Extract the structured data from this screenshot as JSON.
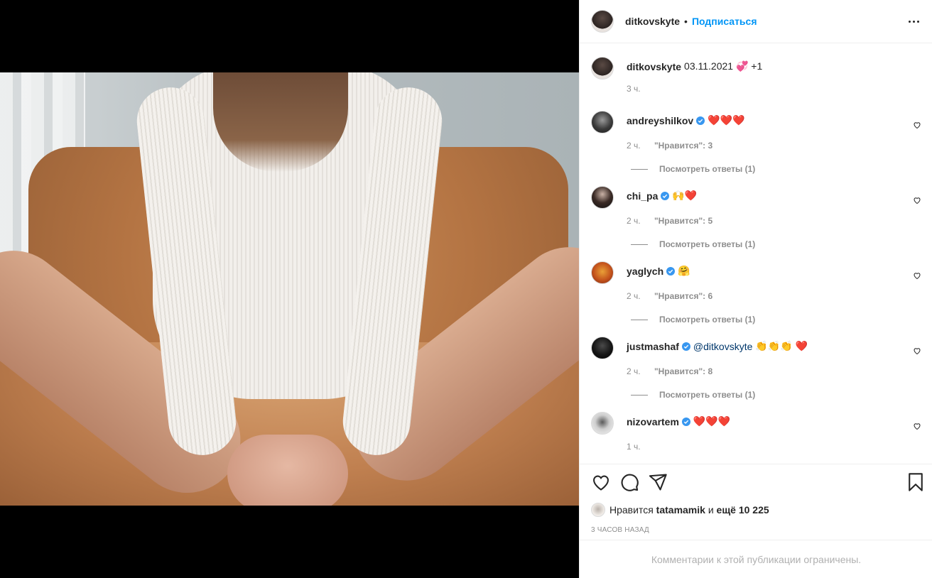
{
  "post": {
    "owner_username": "ditkovskyte",
    "separator": "•",
    "follow_label": "Подписаться",
    "caption_text": "03.11.2021 💞 +1",
    "caption_time": "3 ч."
  },
  "comments": [
    {
      "username": "andreyshilkov",
      "text": "❤️❤️❤️",
      "time": "2 ч.",
      "likes": "\"Нравится\": 3",
      "replies": "Посмотреть ответы (1)"
    },
    {
      "username": "chi_pa",
      "text": "🙌❤️",
      "time": "2 ч.",
      "likes": "\"Нравится\": 5",
      "replies": "Посмотреть ответы (1)"
    },
    {
      "username": "yaglych",
      "text": "🤗",
      "time": "2 ч.",
      "likes": "\"Нравится\": 6",
      "replies": "Посмотреть ответы (1)"
    },
    {
      "username": "justmashaf",
      "mention": "@ditkovskyte",
      "text": "👏👏👏 ❤️",
      "time": "2 ч.",
      "likes": "\"Нравится\": 8",
      "replies": "Посмотреть ответы (1)"
    },
    {
      "username": "nizovartem",
      "text": "❤️❤️❤️",
      "time": "1 ч."
    }
  ],
  "likes_summary": {
    "prefix": "Нравится",
    "user": "tatamamik",
    "joiner": "и",
    "others": "ещё 10 225"
  },
  "posted_ago": "3 ЧАСОВ НАЗАД",
  "comments_limited": "Комментарии к этой публикации ограничены.",
  "icons": {
    "like": "heart-outline-icon",
    "comment": "comment-bubble-icon",
    "share": "paper-plane-icon",
    "save": "bookmark-icon",
    "verified": "verified-badge-icon",
    "more": "more-options-icon"
  },
  "colors": {
    "accent": "#0095f6",
    "verified": "#3897f0",
    "muted": "#8e8e8e",
    "text": "#262626"
  }
}
